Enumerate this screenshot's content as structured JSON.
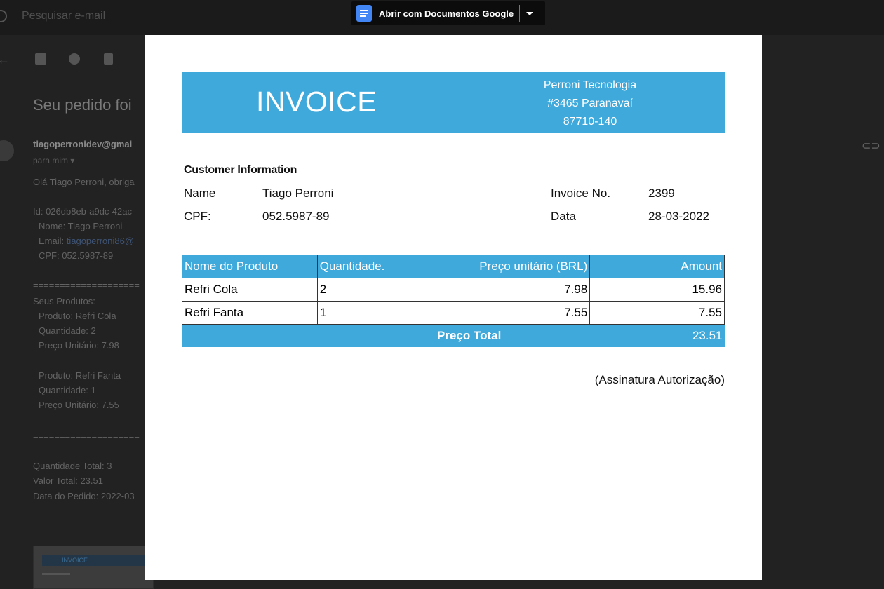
{
  "gmail": {
    "search_placeholder": "Pesquisar e-mail",
    "subject": "Seu pedido foi",
    "sender": "tiagoperronidev@gmai",
    "to": "para mim ▾",
    "body": {
      "greeting": "Olá Tiago Perroni, obriga",
      "id": "Id: 026db8eb-a9dc-42ac-",
      "name": "Nome: Tiago Perroni",
      "email_label": "Email: ",
      "email_link": "tiagoperroni86@",
      "cpf": "CPF: 052.5987-89",
      "divider1": "====================",
      "products_header": "Seus Produtos:",
      "p1_name": "Produto: Refri Cola",
      "p1_qty": "Quantidade: 2",
      "p1_price": "Preço Unitário: 7.98",
      "p2_name": "Produto: Refri Fanta",
      "p2_qty": "Quantidade: 1",
      "p2_price": "Preço Unitário: 7.55",
      "divider2": "====================",
      "total_qty": "Quantidade Total: 3",
      "total_value": "Valor Total: 23.51",
      "order_date": "Data do Pedido: 2022-03"
    },
    "thumbnail_label": "INVOICE"
  },
  "open_bar": {
    "label": "Abrir com Documentos Google"
  },
  "invoice": {
    "title": "INVOICE",
    "company": [
      "Perroni Tecnologia",
      "#3465 Paranavaí",
      "87710-140"
    ],
    "customer_title": "Customer Information",
    "name_label": "Name",
    "name_value": "Tiago Perroni",
    "cpf_label": "CPF:",
    "cpf_value": "052.5987-89",
    "invoice_no_label": "Invoice No.",
    "invoice_no_value": "2399",
    "date_label": "Data",
    "date_value": "28-03-2022",
    "table": {
      "headers": [
        "Nome do Produto",
        "Quantidade.",
        "Preço unitário (BRL)",
        "Amount"
      ],
      "rows": [
        [
          "Refri Cola",
          "2",
          "7.98",
          "15.96"
        ],
        [
          "Refri Fanta",
          "1",
          "7.55",
          "7.55"
        ]
      ],
      "total_label": "Preço Total",
      "total_value": "23.51"
    },
    "signature": "(Assinatura Autorização)"
  },
  "colors": {
    "accent": "#3fa9dc",
    "docs_icon": "#4285f4"
  }
}
